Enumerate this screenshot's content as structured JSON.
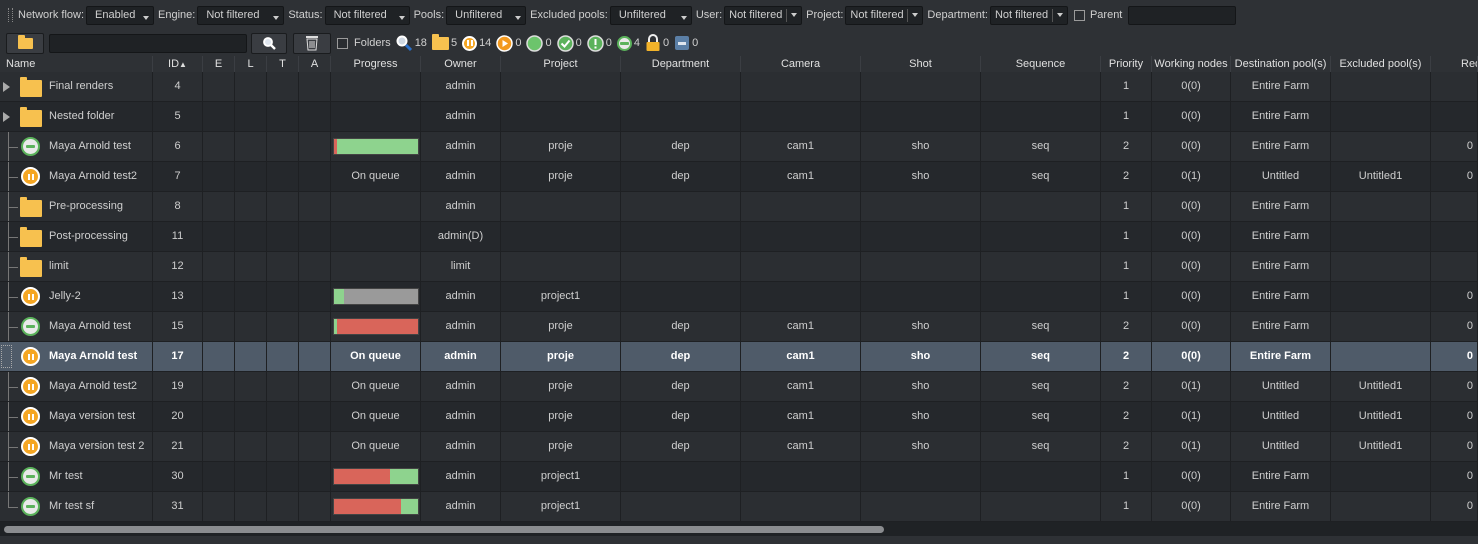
{
  "filters": {
    "network_flow": {
      "label": "Network flow:",
      "value": "Enabled"
    },
    "engine": {
      "label": "Engine:",
      "value": "Not filtered"
    },
    "status": {
      "label": "Status:",
      "value": "Not filtered"
    },
    "pools": {
      "label": "Pools:",
      "value": "Unfiltered"
    },
    "excluded_pools": {
      "label": "Excluded pools:",
      "value": "Unfiltered"
    },
    "user": {
      "label": "User:",
      "value": "Not filtered"
    },
    "project": {
      "label": "Project:",
      "value": "Not filtered"
    },
    "department": {
      "label": "Department:",
      "value": "Not filtered"
    },
    "parent": {
      "label": "Parent",
      "value": ""
    }
  },
  "toolbar2": {
    "folders_label": "Folders",
    "counters": {
      "search": "18",
      "folder": "5",
      "paused": "14",
      "play": "0",
      "green": "0",
      "check": "0",
      "warning": "0",
      "running": "4",
      "lock": "0",
      "disk": "0"
    }
  },
  "columns": {
    "name": "Name",
    "id": "ID",
    "e": "E",
    "l": "L",
    "t": "T",
    "a": "A",
    "progress": "Progress",
    "owner": "Owner",
    "project": "Project",
    "department": "Department",
    "camera": "Camera",
    "shot": "Shot",
    "sequence": "Sequence",
    "priority": "Priority",
    "working_nodes": "Working nodes",
    "dest_pools": "Destination pool(s)",
    "excl_pools": "Excluded pool(s)",
    "requ": "Requ"
  },
  "rows": [
    {
      "icon": "folder",
      "expand": true,
      "name": "Final renders",
      "id": "4",
      "progress": "",
      "owner": "admin",
      "project": "",
      "department": "",
      "camera": "",
      "shot": "",
      "sequence": "",
      "priority": "1",
      "working_nodes": "0(0)",
      "dest_pools": "Entire Farm",
      "excl_pools": "",
      "requ": ""
    },
    {
      "icon": "folder",
      "expand": true,
      "name": "Nested folder",
      "id": "5",
      "progress": "",
      "owner": "admin",
      "project": "",
      "department": "",
      "camera": "",
      "shot": "",
      "sequence": "",
      "priority": "1",
      "working_nodes": "0(0)",
      "dest_pools": "Entire Farm",
      "excl_pools": "",
      "requ": ""
    },
    {
      "icon": "running",
      "tree": true,
      "name": "Maya Arnold test",
      "id": "6",
      "bar": {
        "done": 0.96,
        "style": "red"
      },
      "progress": "",
      "owner": "admin",
      "project": "proje",
      "department": "dep",
      "camera": "cam1",
      "shot": "sho",
      "sequence": "seq",
      "priority": "2",
      "working_nodes": "0(0)",
      "dest_pools": "Entire Farm",
      "excl_pools": "",
      "requ": "0"
    },
    {
      "icon": "paused",
      "tree": true,
      "name": "Maya Arnold test2",
      "id": "7",
      "progress": "On queue",
      "owner": "admin",
      "project": "proje",
      "department": "dep",
      "camera": "cam1",
      "shot": "sho",
      "sequence": "seq",
      "priority": "2",
      "working_nodes": "0(1)",
      "dest_pools": "Untitled",
      "excl_pools": "Untitled1",
      "requ": "0"
    },
    {
      "icon": "folder",
      "tree": true,
      "name": "Pre-processing",
      "id": "8",
      "progress": "",
      "owner": "admin",
      "project": "",
      "department": "",
      "camera": "",
      "shot": "",
      "sequence": "",
      "priority": "1",
      "working_nodes": "0(0)",
      "dest_pools": "Entire Farm",
      "excl_pools": "",
      "requ": ""
    },
    {
      "icon": "folder",
      "tree": true,
      "name": "Post-processing",
      "id": "11",
      "progress": "",
      "owner": "admin(D)",
      "project": "",
      "department": "",
      "camera": "",
      "shot": "",
      "sequence": "",
      "priority": "1",
      "working_nodes": "0(0)",
      "dest_pools": "Entire Farm",
      "excl_pools": "",
      "requ": ""
    },
    {
      "icon": "folder",
      "tree": true,
      "name": "limit",
      "id": "12",
      "progress": "",
      "owner": "limit",
      "project": "",
      "department": "",
      "camera": "",
      "shot": "",
      "sequence": "",
      "priority": "1",
      "working_nodes": "0(0)",
      "dest_pools": "Entire Farm",
      "excl_pools": "",
      "requ": ""
    },
    {
      "icon": "paused",
      "tree": true,
      "name": "Jelly-2",
      "id": "13",
      "bar": {
        "done": 0.12,
        "style": "gray"
      },
      "progress": "",
      "owner": "admin",
      "project": "project1",
      "department": "",
      "camera": "",
      "shot": "",
      "sequence": "",
      "priority": "1",
      "working_nodes": "0(0)",
      "dest_pools": "Entire Farm",
      "excl_pools": "",
      "requ": "0"
    },
    {
      "icon": "running",
      "tree": true,
      "name": "Maya Arnold test",
      "id": "15",
      "bar": {
        "done": 0.03,
        "style": "red-left"
      },
      "progress": "",
      "owner": "admin",
      "project": "proje",
      "department": "dep",
      "camera": "cam1",
      "shot": "sho",
      "sequence": "seq",
      "priority": "2",
      "working_nodes": "0(0)",
      "dest_pools": "Entire Farm",
      "excl_pools": "",
      "requ": "0"
    },
    {
      "icon": "paused",
      "tree": true,
      "selected": true,
      "name": "Maya Arnold test",
      "id": "17",
      "progress": "On queue",
      "owner": "admin",
      "project": "proje",
      "department": "dep",
      "camera": "cam1",
      "shot": "sho",
      "sequence": "seq",
      "priority": "2",
      "working_nodes": "0(0)",
      "dest_pools": "Entire Farm",
      "excl_pools": "",
      "requ": "0"
    },
    {
      "icon": "paused",
      "tree": true,
      "name": "Maya Arnold test2",
      "id": "19",
      "progress": "On queue",
      "owner": "admin",
      "project": "proje",
      "department": "dep",
      "camera": "cam1",
      "shot": "sho",
      "sequence": "seq",
      "priority": "2",
      "working_nodes": "0(1)",
      "dest_pools": "Untitled",
      "excl_pools": "Untitled1",
      "requ": "0"
    },
    {
      "icon": "paused",
      "tree": true,
      "name": "Maya version test",
      "id": "20",
      "progress": "On queue",
      "owner": "admin",
      "project": "proje",
      "department": "dep",
      "camera": "cam1",
      "shot": "sho",
      "sequence": "seq",
      "priority": "2",
      "working_nodes": "0(1)",
      "dest_pools": "Untitled",
      "excl_pools": "Untitled1",
      "requ": "0"
    },
    {
      "icon": "paused",
      "tree": true,
      "name": "Maya version test 2",
      "id": "21",
      "progress": "On queue",
      "owner": "admin",
      "project": "proje",
      "department": "dep",
      "camera": "cam1",
      "shot": "sho",
      "sequence": "seq",
      "priority": "2",
      "working_nodes": "0(1)",
      "dest_pools": "Untitled",
      "excl_pools": "Untitled1",
      "requ": "0"
    },
    {
      "icon": "running",
      "tree": true,
      "name": "Mr test",
      "id": "30",
      "bar": {
        "done": 0.33,
        "style": "red"
      },
      "progress": "",
      "owner": "admin",
      "project": "project1",
      "department": "",
      "camera": "",
      "shot": "",
      "sequence": "",
      "priority": "1",
      "working_nodes": "0(0)",
      "dest_pools": "Entire Farm",
      "excl_pools": "",
      "requ": "0"
    },
    {
      "icon": "running",
      "tree": true,
      "last": true,
      "name": "Mr test sf",
      "id": "31",
      "bar": {
        "done": 0.2,
        "style": "red"
      },
      "progress": "",
      "owner": "admin",
      "project": "project1",
      "department": "",
      "camera": "",
      "shot": "",
      "sequence": "",
      "priority": "1",
      "working_nodes": "0(0)",
      "dest_pools": "Entire Farm",
      "excl_pools": "",
      "requ": "0"
    }
  ]
}
